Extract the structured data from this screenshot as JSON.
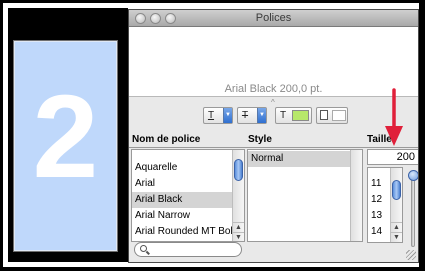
{
  "window": {
    "title": "Polices",
    "preview_text": "Arial Black 200,0 pt."
  },
  "preview_card": {
    "digit": "2",
    "background": "#bfd8fb"
  },
  "toolbar": {
    "underline_icon": "T",
    "strike_icon": "T",
    "text_color_icon": "T",
    "text_color": "#b7e86a",
    "document_color": "#ffffff"
  },
  "columns": {
    "name": "Nom de police",
    "style": "Style",
    "size": "Taille"
  },
  "font_list": {
    "items": [
      "Aquarelle",
      "Arial",
      "Arial Black",
      "Arial Narrow",
      "Arial Rounded MT Bol"
    ],
    "selected": "Arial Black"
  },
  "style_list": {
    "items": [
      "Normal"
    ]
  },
  "size": {
    "value": "200",
    "options": [
      "11",
      "12",
      "13",
      "14"
    ]
  },
  "search": {
    "placeholder": ""
  },
  "annotation": {
    "arrow_color": "#e0203a"
  }
}
